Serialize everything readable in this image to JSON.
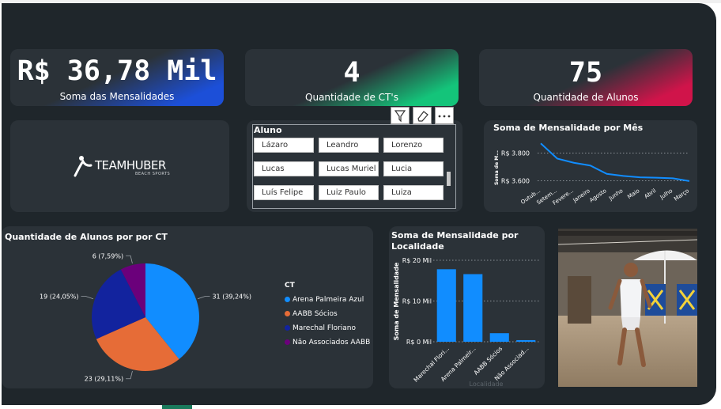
{
  "kpis": {
    "soma_mensalidades": {
      "value": "R$ 36,78 Mil",
      "label": "Soma das Mensalidades"
    },
    "quantidade_cts": {
      "value": "4",
      "label": "Quantidade de CT's"
    },
    "quantidade_alunos": {
      "value": "75",
      "label": "Quantidade de Alunos"
    }
  },
  "logo": {
    "text": "TEAMHUBER",
    "subtext": "BEACH SPORTS"
  },
  "slicer": {
    "title": "Aluno",
    "items": [
      "Lázaro",
      "Leandro",
      "Lorenzo",
      "Lucas",
      "Lucas Muriel",
      "Lucia",
      "Luís Felipe",
      "Luiz Paulo",
      "Luiza"
    ],
    "toolbar": [
      "filter-icon",
      "eraser-icon",
      "more-options-icon"
    ]
  },
  "colors": {
    "canvas": "#1f262b",
    "card": "#2b3238",
    "blue": "#118dff",
    "orange": "#e66c37",
    "navy": "#12239e",
    "purple": "#6b007b",
    "accent_blue": "#1c4fd8",
    "accent_green": "#14c47a",
    "accent_red": "#d0144a"
  },
  "chart_data": [
    {
      "id": "line",
      "type": "line",
      "title": "Soma de Mensalidade por Mês",
      "ylabel": "Soma de M...",
      "categories": [
        "Outubro",
        "Setembro",
        "Fevereiro",
        "Janeiro",
        "Agosto",
        "Junho",
        "Maio",
        "Abril",
        "Julho",
        "Março"
      ],
      "category_labels": [
        "Outub...",
        "Setem...",
        "Fevere...",
        "Janeiro",
        "Agosto",
        "Junho",
        "Maio",
        "Abril",
        "Julho",
        "Março"
      ],
      "values": [
        3870,
        3760,
        3730,
        3710,
        3650,
        3635,
        3625,
        3622,
        3618,
        3598
      ],
      "yticks": [
        "R$ 3.800",
        "R$ 3.600"
      ],
      "ytick_values": [
        3800,
        3600
      ],
      "ylim": [
        3580,
        3900
      ],
      "grid": true
    },
    {
      "id": "pie",
      "type": "pie",
      "title": "Quantidade de Alunos por por CT",
      "legend_title": "CT",
      "legend_position": "right",
      "slices": [
        {
          "name": "Arena Palmeira Azul",
          "value": 31,
          "label": "31 (39,24%)",
          "color": "#118dff"
        },
        {
          "name": "AABB Sócios",
          "value": 23,
          "label": "23 (29,11%)",
          "color": "#e66c37"
        },
        {
          "name": "Marechal Floriano",
          "value": 19,
          "label": "19 (24,05%)",
          "color": "#12239e"
        },
        {
          "name": "Não Associados AABB",
          "value": 6,
          "label": "6 (7,59%)",
          "color": "#6b007b"
        }
      ]
    },
    {
      "id": "bar",
      "type": "bar",
      "title": "Soma de Mensalidade por Localidade",
      "title_lines": [
        "Soma de Mensalidade por",
        "Localidade"
      ],
      "xlabel": "Localidade",
      "ylabel": "Soma de Mensalidade",
      "categories": [
        "Marechal Flori...",
        "Arena Palmeir...",
        "AABB Sócios",
        "Não Associad..."
      ],
      "values": [
        17.8,
        16.6,
        2.1,
        0.4
      ],
      "yticks": [
        "R$ 20 Mil",
        "R$ 10 Mil",
        "R$ 0 Mil"
      ],
      "ytick_values": [
        20,
        10,
        0
      ],
      "ylim": [
        0,
        20
      ],
      "color": "#118dff",
      "grid": true
    }
  ]
}
